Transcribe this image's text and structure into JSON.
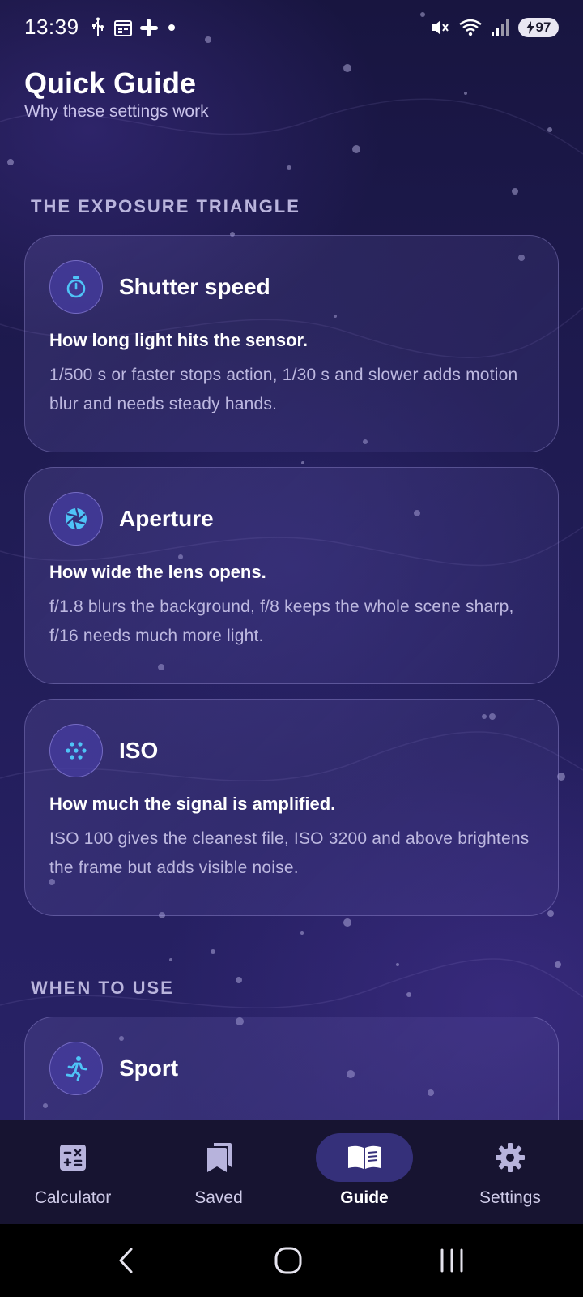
{
  "status_bar": {
    "time": "13:39",
    "left_icons": [
      "usb-icon",
      "calendar-icon",
      "slack-icon",
      "dot-icon"
    ],
    "right_icons": [
      "mute-icon",
      "wifi-icon",
      "signal-icon"
    ],
    "battery": "97"
  },
  "header": {
    "title": "Quick Guide",
    "subtitle": "Why these settings work"
  },
  "sections": [
    {
      "title": "THE EXPOSURE TRIANGLE"
    },
    {
      "title": "WHEN TO USE"
    }
  ],
  "cards": [
    {
      "icon": "timer-icon",
      "title": "Shutter speed",
      "lead": "How long light hits the sensor.",
      "body": "1/500 s or faster stops action, 1/30 s and slower adds motion blur and needs steady hands."
    },
    {
      "icon": "aperture-icon",
      "title": "Aperture",
      "lead": "How wide the lens opens.",
      "body": "f/1.8 blurs the background, f/8 keeps the whole scene sharp, f/16 needs much more light."
    },
    {
      "icon": "grain-icon",
      "title": "ISO",
      "lead": "How much the signal is amplified.",
      "body": "ISO 100 gives the cleanest file, ISO 3200 and above brightens the frame but adds visible noise."
    },
    {
      "icon": "running-icon",
      "title": "Sport"
    }
  ],
  "bottom_nav": {
    "items": [
      {
        "label": "Calculator",
        "icon": "calculator-icon"
      },
      {
        "label": "Saved",
        "icon": "bookmarks-icon"
      },
      {
        "label": "Guide",
        "icon": "book-icon",
        "active": true
      },
      {
        "label": "Settings",
        "icon": "gear-icon"
      }
    ]
  },
  "colors": {
    "accent": "#4fc3f7",
    "nav_active_pill": "#35307a",
    "body_text": "#bdb8e0"
  }
}
